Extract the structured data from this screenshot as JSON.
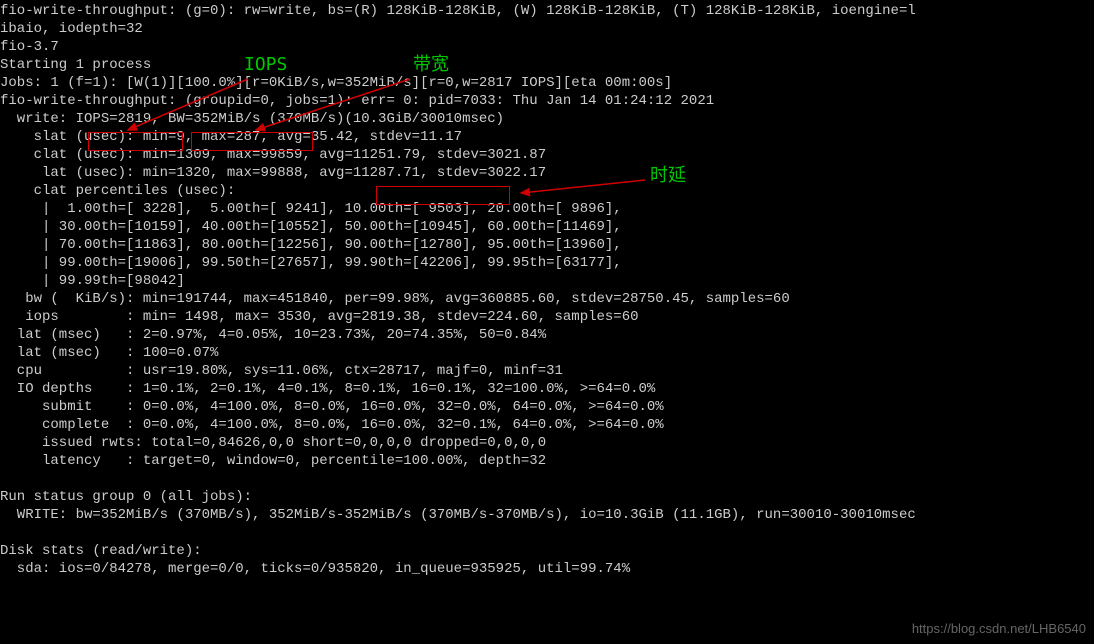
{
  "lines": [
    "fio-write-throughput: (g=0): rw=write, bs=(R) 128KiB-128KiB, (W) 128KiB-128KiB, (T) 128KiB-128KiB, ioengine=l",
    "ibaio, iodepth=32",
    "fio-3.7",
    "Starting 1 process",
    "Jobs: 1 (f=1): [W(1)][100.0%][r=0KiB/s,w=352MiB/s][r=0,w=2817 IOPS][eta 00m:00s]",
    "fio-write-throughput: (groupid=0, jobs=1): err= 0: pid=7033: Thu Jan 14 01:24:12 2021",
    "  write: IOPS=2819, BW=352MiB/s (370MB/s)(10.3GiB/30010msec)",
    "    slat (usec): min=9, max=287, avg=35.42, stdev=11.17",
    "    clat (usec): min=1309, max=99859, avg=11251.79, stdev=3021.87",
    "     lat (usec): min=1320, max=99888, avg=11287.71, stdev=3022.17",
    "    clat percentiles (usec):",
    "     |  1.00th=[ 3228],  5.00th=[ 9241], 10.00th=[ 9503], 20.00th=[ 9896],",
    "     | 30.00th=[10159], 40.00th=[10552], 50.00th=[10945], 60.00th=[11469],",
    "     | 70.00th=[11863], 80.00th=[12256], 90.00th=[12780], 95.00th=[13960],",
    "     | 99.00th=[19006], 99.50th=[27657], 99.90th=[42206], 99.95th=[63177],",
    "     | 99.99th=[98042]",
    "   bw (  KiB/s): min=191744, max=451840, per=99.98%, avg=360885.60, stdev=28750.45, samples=60",
    "   iops        : min= 1498, max= 3530, avg=2819.38, stdev=224.60, samples=60",
    "  lat (msec)   : 2=0.97%, 4=0.05%, 10=23.73%, 20=74.35%, 50=0.84%",
    "  lat (msec)   : 100=0.07%",
    "  cpu          : usr=19.80%, sys=11.06%, ctx=28717, majf=0, minf=31",
    "  IO depths    : 1=0.1%, 2=0.1%, 4=0.1%, 8=0.1%, 16=0.1%, 32=100.0%, >=64=0.0%",
    "     submit    : 0=0.0%, 4=100.0%, 8=0.0%, 16=0.0%, 32=0.0%, 64=0.0%, >=64=0.0%",
    "     complete  : 0=0.0%, 4=100.0%, 8=0.0%, 16=0.0%, 32=0.1%, 64=0.0%, >=64=0.0%",
    "     issued rwts: total=0,84626,0,0 short=0,0,0,0 dropped=0,0,0,0",
    "     latency   : target=0, window=0, percentile=100.00%, depth=32",
    "",
    "Run status group 0 (all jobs):",
    "  WRITE: bw=352MiB/s (370MB/s), 352MiB/s-352MiB/s (370MB/s-370MB/s), io=10.3GiB (11.1GB), run=30010-30010msec",
    "",
    "Disk stats (read/write):",
    "  sda: ios=0/84278, merge=0/0, ticks=0/935820, in_queue=935925, util=99.74%"
  ],
  "labels": {
    "iops": "IOPS",
    "bandwidth": "带宽",
    "latency": "时延"
  },
  "watermark": "https://blog.csdn.net/LHB6540",
  "highlight_metrics": {
    "iops": "IOPS=2819",
    "bw": "BW=352MiB/s",
    "lat_avg": "avg=11287.71"
  }
}
